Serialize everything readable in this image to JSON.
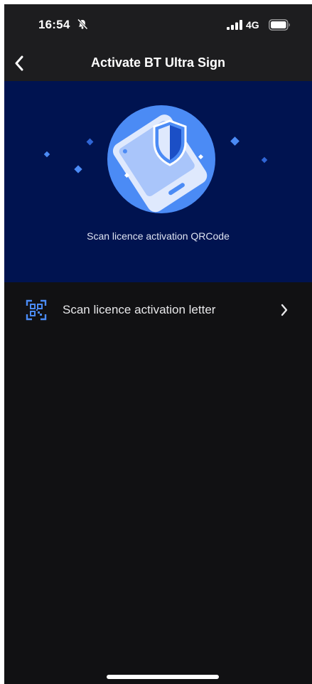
{
  "status_bar": {
    "time": "16:54",
    "network": "4G",
    "icons": [
      "bell-slash-icon",
      "signal-icon",
      "battery-icon"
    ]
  },
  "nav": {
    "back_icon": "chevron-left-icon",
    "title": "Activate BT Ultra Sign"
  },
  "hero": {
    "illustration": "phone-shield-icon",
    "caption": "Scan licence activation QRCode"
  },
  "list": {
    "items": [
      {
        "icon": "qr-scan-icon",
        "label": "Scan licence activation letter",
        "trailing_icon": "chevron-right-icon"
      }
    ]
  },
  "colors": {
    "background": "#111113",
    "bar": "#1d1d1f",
    "hero": "#001350",
    "accent": "#4b8bf5"
  }
}
